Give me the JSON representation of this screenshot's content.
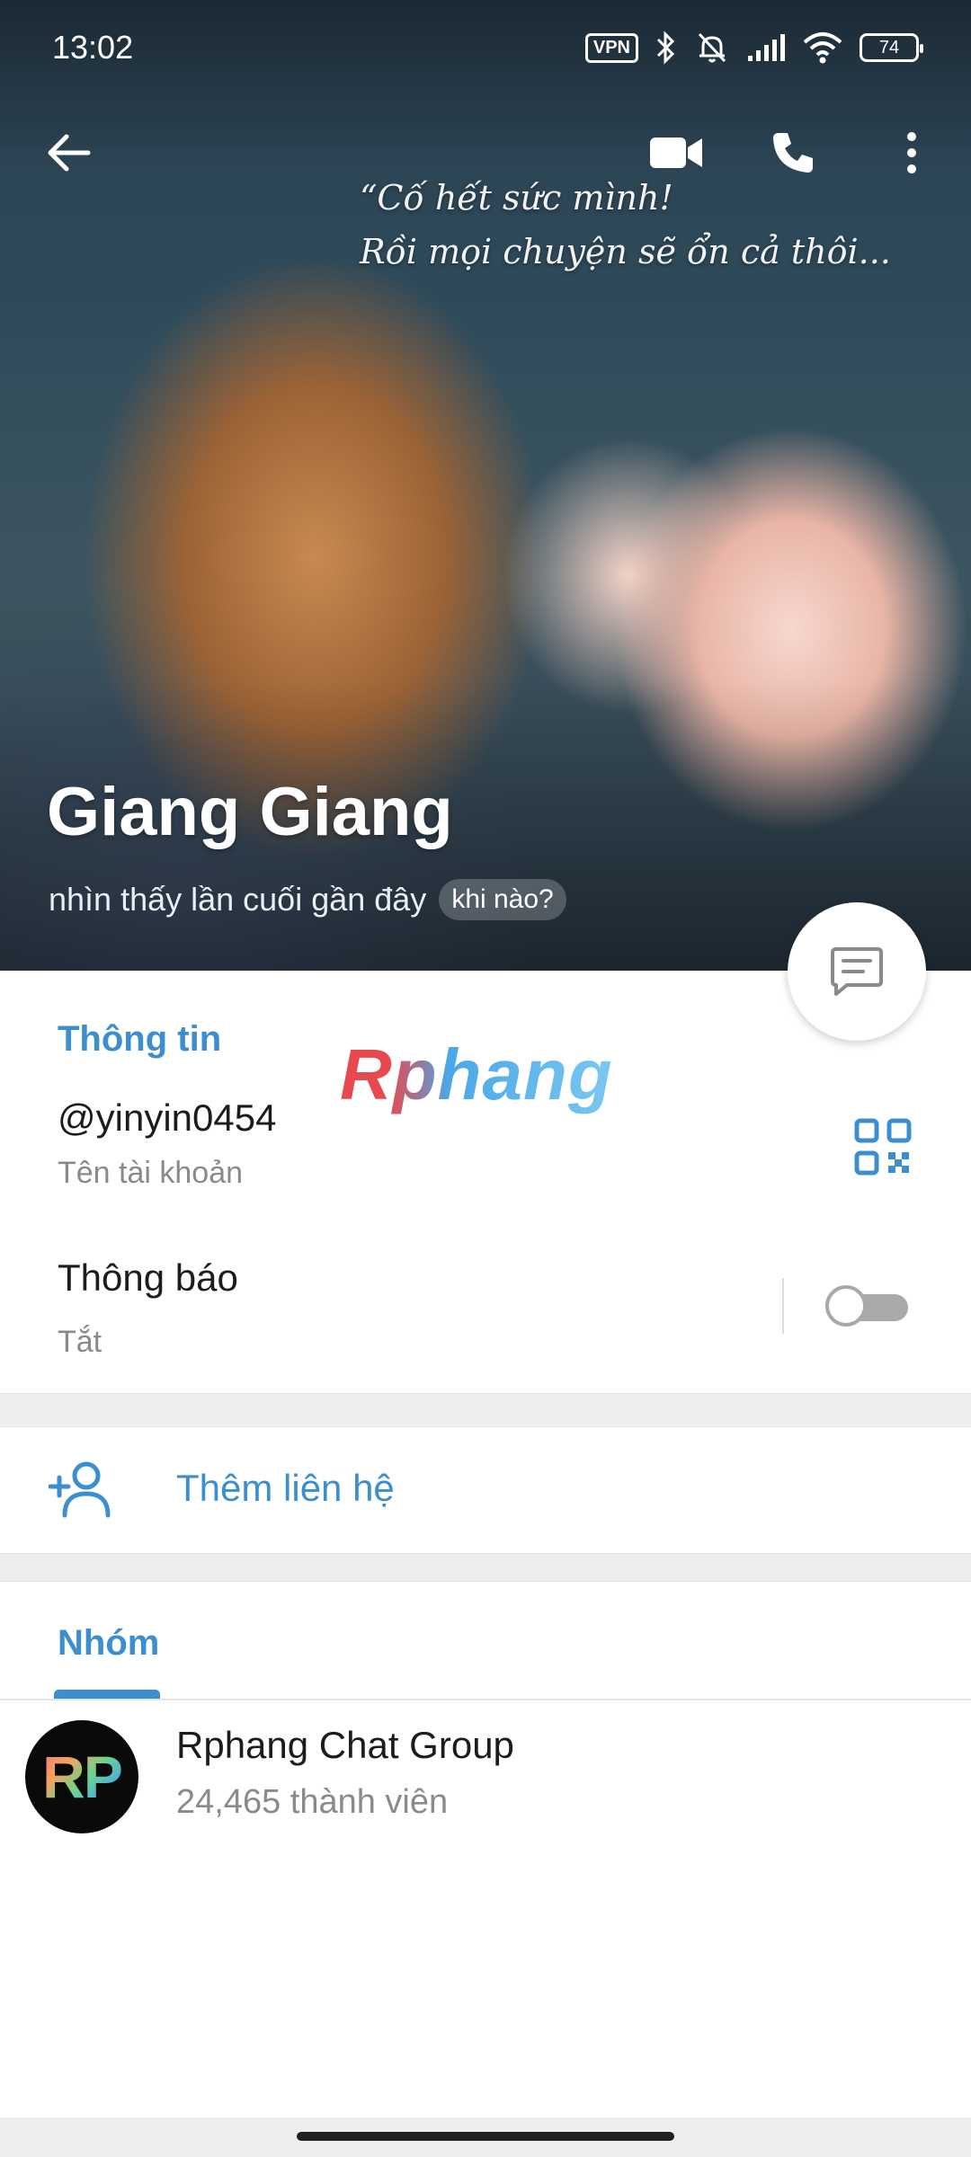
{
  "status_bar": {
    "time": "13:02",
    "vpn": "VPN",
    "battery": "74"
  },
  "hero": {
    "quote_line1": "“Cố hết sức mình!",
    "quote_line2": "Rồi mọi chuyện sẽ ổn cả thôi...",
    "name": "Giang Giang",
    "last_seen": "nhìn thấy lần cuối gần đây",
    "when_chip": "khi nào?",
    "icons": [
      "back-arrow-icon",
      "video-call-icon",
      "phone-icon",
      "more-vertical-icon"
    ]
  },
  "info": {
    "title": "Thông tin",
    "watermark": "Rphang",
    "username": "@yinyin0454",
    "username_label": "Tên tài khoản",
    "notifications_title": "Thông báo",
    "notifications_value": "Tắt",
    "notifications_enabled": false
  },
  "add_contact": {
    "label": "Thêm liên hệ"
  },
  "groups": {
    "tab_label": "Nhóm",
    "items": [
      {
        "avatar_text": "RP",
        "name": "Rphang Chat Group",
        "members": "24,465 thành viên"
      }
    ]
  },
  "colors": {
    "accent": "#3d8ecf",
    "toggle_off": "#a9a9a9"
  }
}
